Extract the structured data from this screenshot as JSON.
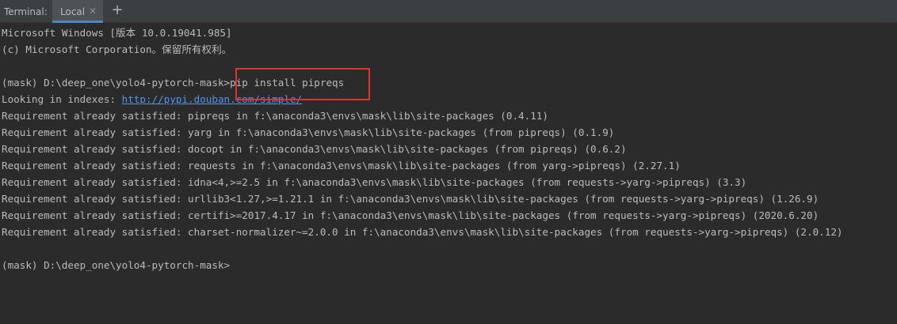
{
  "tool_window": {
    "title": "Terminal:",
    "tabs": [
      {
        "label": "Local",
        "close_icon": "close-icon",
        "active": true
      }
    ],
    "add_tab_icon": "plus-icon",
    "accent_color": "#4a88c7"
  },
  "terminal": {
    "header_lines": [
      "Microsoft Windows [版本 10.0.19041.985]",
      "(c) Microsoft Corporation。保留所有权利。"
    ],
    "command": {
      "prompt": "(mask) D:\\deep_one\\yolo4-pytorch-mask>",
      "text": "pip install pipreqs"
    },
    "index_line": {
      "prefix": "Looking in indexes: ",
      "url": "http://pypi.douban.com/simple/"
    },
    "output_lines": [
      "Requirement already satisfied: pipreqs in f:\\anaconda3\\envs\\mask\\lib\\site-packages (0.4.11)",
      "Requirement already satisfied: yarg in f:\\anaconda3\\envs\\mask\\lib\\site-packages (from pipreqs) (0.1.9)",
      "Requirement already satisfied: docopt in f:\\anaconda3\\envs\\mask\\lib\\site-packages (from pipreqs) (0.6.2)",
      "Requirement already satisfied: requests in f:\\anaconda3\\envs\\mask\\lib\\site-packages (from yarg->pipreqs) (2.27.1)",
      "Requirement already satisfied: idna<4,>=2.5 in f:\\anaconda3\\envs\\mask\\lib\\site-packages (from requests->yarg->pipreqs) (3.3)",
      "Requirement already satisfied: urllib3<1.27,>=1.21.1 in f:\\anaconda3\\envs\\mask\\lib\\site-packages (from requests->yarg->pipreqs) (1.26.9)",
      "Requirement already satisfied: certifi>=2017.4.17 in f:\\anaconda3\\envs\\mask\\lib\\site-packages (from requests->yarg->pipreqs) (2020.6.20)",
      "Requirement already satisfied: charset-normalizer~=2.0.0 in f:\\anaconda3\\envs\\mask\\lib\\site-packages (from requests->yarg->pipreqs) (2.0.12)"
    ],
    "final_prompt": "(mask) D:\\deep_one\\yolo4-pytorch-mask>",
    "highlight_color": "#e3322a"
  }
}
